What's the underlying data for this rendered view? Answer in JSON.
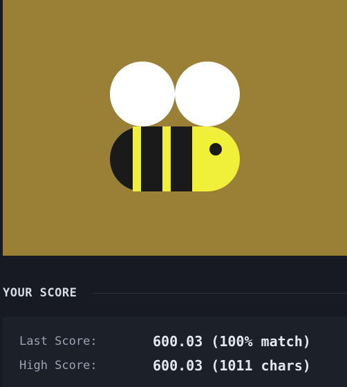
{
  "preview": {
    "background_color": "#9a7f36",
    "wing_color": "#ffffff",
    "body_dark_color": "#1a1a1a",
    "body_yellow_color": "#f0f03a",
    "description": "bee drawing"
  },
  "score": {
    "heading": "YOUR SCORE",
    "last_label": "Last Score:",
    "last_value": "600.03 (100% match)",
    "high_label": "High Score:",
    "high_value": "600.03 (1011 chars)"
  }
}
